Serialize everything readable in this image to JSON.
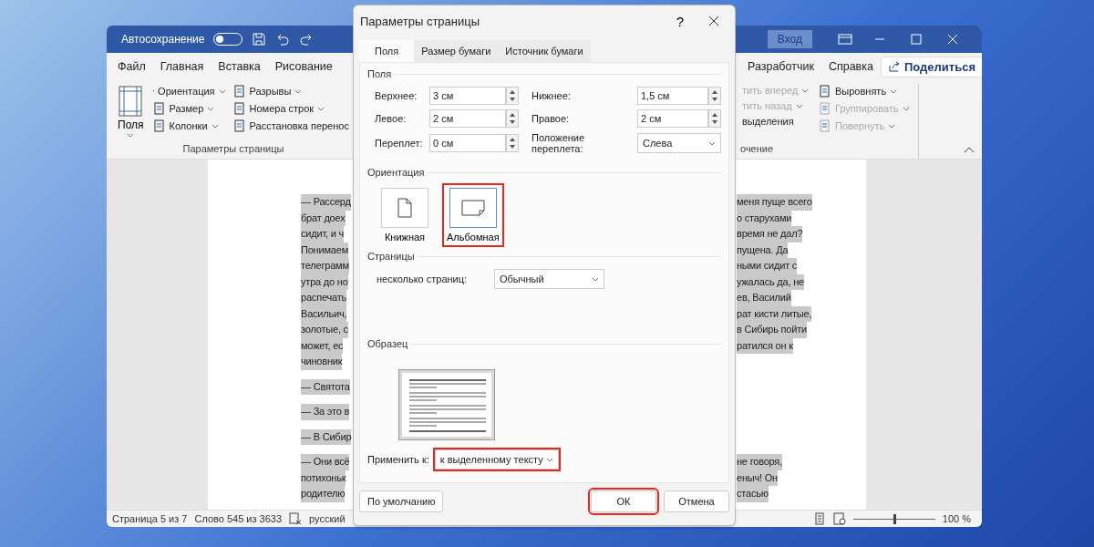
{
  "titlebar": {
    "autosave_label": "Автосохранение",
    "autosave_on": false,
    "signin": "Вход"
  },
  "menu_tabs_left": [
    "Файл",
    "Главная",
    "Вставка",
    "Рисование"
  ],
  "menu_tabs_right": [
    "Разработчик",
    "Справка"
  ],
  "share_button": "Поделиться",
  "ribbon_left": {
    "big_button": "Поля",
    "column_1": [
      {
        "label": "Ориентация"
      },
      {
        "label": "Размер"
      },
      {
        "label": "Колонки"
      }
    ],
    "column_2": [
      {
        "label": "Разрывы"
      },
      {
        "label": "Номера строк"
      },
      {
        "label": "Расстановка перенос"
      }
    ],
    "group_label": "Параметры страницы"
  },
  "ribbon_right": {
    "column_1": [
      {
        "label": "тить вперед",
        "disabled": true
      },
      {
        "label": "тить назад",
        "disabled": true
      },
      {
        "label": "выделения",
        "disabled": false
      }
    ],
    "column_2": [
      {
        "label": "Выровнять",
        "disabled": false
      },
      {
        "label": "Группировать",
        "disabled": true
      },
      {
        "label": "Повернуть",
        "disabled": true
      }
    ],
    "group_label": "очение"
  },
  "document": [
    {
      "lines": [
        {
          "left": "— Рассерд",
          "right": "меня пуще всего"
        },
        {
          "left": "брат доех",
          "right": "о старухами"
        },
        {
          "left": "сидит, и ч",
          "right": "время не дал?"
        },
        {
          "left": "Понимаем",
          "right": "пущена. Да"
        },
        {
          "left": "телеграмм",
          "right": "ными сидит с"
        },
        {
          "left": "утра до но",
          "right": "ужалась да, не"
        },
        {
          "left": "распечать",
          "right": "ев, Василий"
        },
        {
          "left": "Васильич,",
          "right": "рат кисти литые,"
        },
        {
          "left": "золотые, с",
          "right": "в Сибирь пойти"
        },
        {
          "left": "может, ес",
          "right": "ратился он к"
        },
        {
          "left": "чиновник"
        }
      ]
    },
    {
      "lines": [
        {
          "left": "— Святота"
        }
      ]
    },
    {
      "lines": [
        {
          "left": "— За это в"
        }
      ]
    },
    {
      "lines": [
        {
          "left": "— В Сибир"
        }
      ]
    },
    {
      "lines": [
        {
          "left": "— Они всё",
          "right": "не говоря,"
        },
        {
          "left": "потихоньк",
          "right": "еныч! Он"
        },
        {
          "left": "родителю",
          "right": "стасью"
        }
      ]
    }
  ],
  "status_bar": {
    "page": "Страница 5 из 7",
    "words": "Слово 545 из 3633",
    "language": "русский",
    "zoom": "100 %",
    "zoom_slider": {
      "level": 0.5
    }
  },
  "dialog": {
    "title": "Параметры страницы",
    "help": "?",
    "tabs": [
      {
        "label": "Поля",
        "selected": true
      },
      {
        "label": "Размер бумаги",
        "selected": false
      },
      {
        "label": "Источник бумаги",
        "selected": false
      }
    ],
    "margins_heading": "Поля",
    "margins_left": [
      {
        "label": "Верхнее:",
        "value": "3 см"
      },
      {
        "label": "Левое:",
        "value": "2 см"
      },
      {
        "label": "Переплет:",
        "value": "0 см"
      }
    ],
    "margins_right": [
      {
        "label": "Нижнее:",
        "value": "1,5 см"
      },
      {
        "label": "Правое:",
        "value": "2 см"
      }
    ],
    "gutter_position": {
      "label": "Положение переплета:",
      "value": "Слева"
    },
    "orientation_heading": "Ориентация",
    "orientations": [
      {
        "label": "Книжная",
        "kind": "portrait",
        "selected": false,
        "highlighted": false
      },
      {
        "label": "Альбомная",
        "kind": "landscape",
        "selected": true,
        "highlighted": true
      }
    ],
    "pages_heading": "Страницы",
    "multiple_pages": {
      "label": "несколько страниц:",
      "value": "Обычный"
    },
    "preview_heading": "Образец",
    "apply_to": {
      "label": "Применить к:",
      "value": "к выделенному тексту",
      "highlighted": true
    },
    "default_button": "По умолчанию",
    "ok_button": {
      "label": "ОК",
      "highlighted": true
    },
    "cancel_button": "Отмена"
  }
}
